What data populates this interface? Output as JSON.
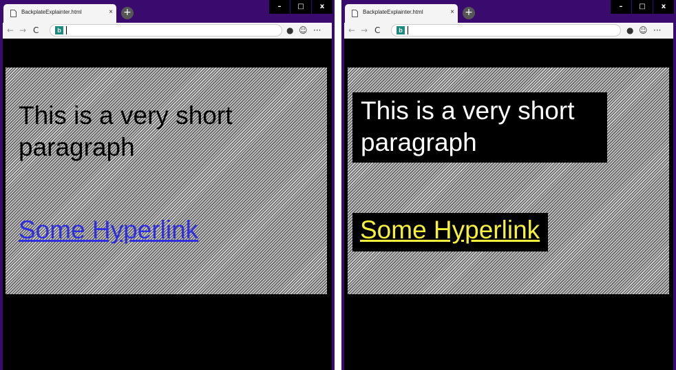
{
  "windows": [
    {
      "tab": {
        "title": "BackplateExplainter.html",
        "close": "×"
      },
      "new_tab": "+",
      "controls": {
        "minimize": "–",
        "maximize": "□",
        "close": "x"
      },
      "toolbar": {
        "back": "←",
        "forward": "→",
        "reload": "C",
        "search_badge": "b",
        "profile": "●",
        "emoji": "☺",
        "more": "···"
      },
      "content": {
        "paragraph": "This is a very short paragraph",
        "link": "Some Hyperlink"
      },
      "colors": {
        "text": "#000000",
        "link": "#2f2fe0",
        "backplate": "none"
      }
    },
    {
      "tab": {
        "title": "BackplateExplainter.html",
        "close": "×"
      },
      "new_tab": "+",
      "controls": {
        "minimize": "–",
        "maximize": "□",
        "close": "x"
      },
      "toolbar": {
        "back": "←",
        "forward": "→",
        "reload": "C",
        "search_badge": "b",
        "profile": "●",
        "emoji": "☺",
        "more": "···"
      },
      "content": {
        "paragraph": "This is a very short paragraph",
        "link": "Some Hyperlink"
      },
      "colors": {
        "text": "#ffffff",
        "link": "#f5f03a",
        "backplate": "#000000"
      }
    }
  ]
}
